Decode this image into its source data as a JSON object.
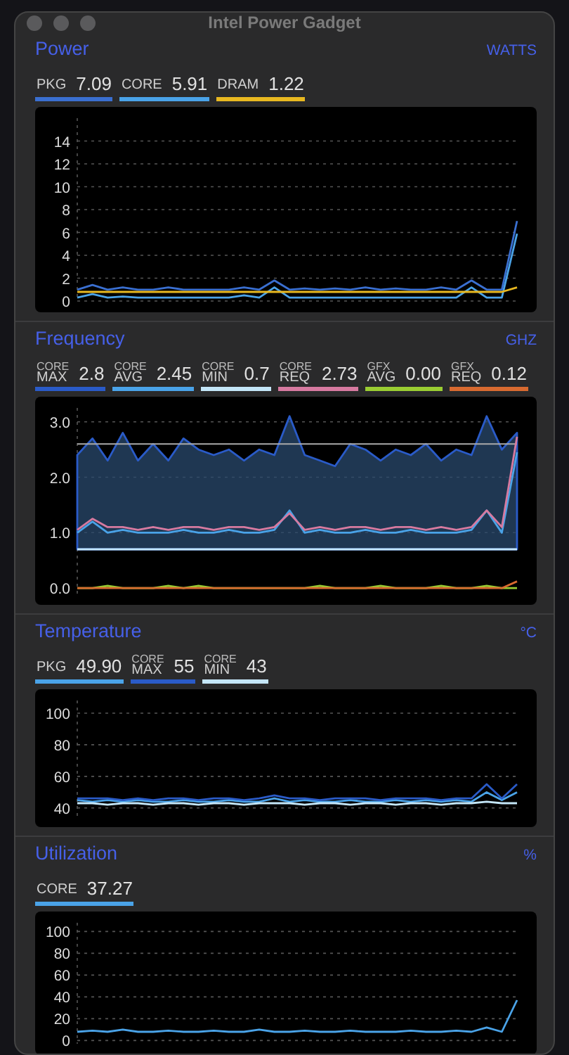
{
  "window": {
    "title": "Intel Power Gadget"
  },
  "sections": [
    {
      "title": "Power",
      "unit": "WATTS",
      "metrics": [
        {
          "label": "PKG",
          "value": "7.09",
          "color": "#3a6fd0"
        },
        {
          "label": "CORE",
          "value": "5.91",
          "color": "#4aa3e8"
        },
        {
          "label": "DRAM",
          "value": "1.22",
          "color": "#e8b820"
        }
      ],
      "chart_data": {
        "type": "line",
        "grid": true,
        "ylim": [
          0,
          16
        ],
        "yticks": [
          0,
          2,
          4,
          6,
          8,
          10,
          12,
          14
        ],
        "series": [
          {
            "color": "#3a6fd0",
            "values": [
              1.0,
              1.4,
              1.0,
              1.2,
              1.0,
              1.0,
              1.2,
              1.0,
              1.0,
              1.0,
              1.0,
              1.2,
              1.0,
              1.8,
              1.0,
              1.1,
              1.0,
              1.1,
              1.0,
              1.2,
              1.0,
              1.1,
              1.0,
              1.0,
              1.2,
              1.0,
              1.8,
              1.0,
              1.0,
              7.0
            ]
          },
          {
            "color": "#4aa3e8",
            "values": [
              0.3,
              0.6,
              0.3,
              0.4,
              0.3,
              0.3,
              0.3,
              0.3,
              0.3,
              0.3,
              0.3,
              0.5,
              0.3,
              1.2,
              0.3,
              0.3,
              0.3,
              0.3,
              0.3,
              0.3,
              0.3,
              0.3,
              0.3,
              0.3,
              0.3,
              0.3,
              1.2,
              0.3,
              0.3,
              5.9
            ]
          },
          {
            "color": "#e8b820",
            "values": [
              0.8,
              0.8,
              0.8,
              0.8,
              0.8,
              0.8,
              0.8,
              0.8,
              0.8,
              0.8,
              0.8,
              0.8,
              0.8,
              0.8,
              0.8,
              0.8,
              0.8,
              0.8,
              0.8,
              0.8,
              0.8,
              0.8,
              0.8,
              0.8,
              0.8,
              0.8,
              0.8,
              0.8,
              0.8,
              1.2
            ]
          }
        ]
      }
    },
    {
      "title": "Frequency",
      "unit": "GHZ",
      "metrics": [
        {
          "label_top": "CORE",
          "label": "MAX",
          "value": "2.8",
          "color": "#2a5bc8"
        },
        {
          "label_top": "CORE",
          "label": "AVG",
          "value": "2.45",
          "color": "#4aa3e8"
        },
        {
          "label_top": "CORE",
          "label": "MIN",
          "value": "0.7",
          "color": "#c4e6f8"
        },
        {
          "label_top": "CORE",
          "label": "REQ",
          "value": "2.73",
          "color": "#d77aa0"
        },
        {
          "label_top": "GFX",
          "label": "AVG",
          "value": "0.00",
          "color": "#9acd32"
        },
        {
          "label_top": "GFX",
          "label": "REQ",
          "value": "0.12",
          "color": "#d86a30"
        }
      ],
      "chart_data": {
        "type": "line",
        "grid": true,
        "ylim": [
          -0.1,
          3.25
        ],
        "yticks": [
          {
            "value": 0,
            "label": "0.0"
          },
          {
            "value": 1,
            "label": "1.0"
          },
          {
            "value": 2,
            "label": "2.0"
          },
          {
            "value": 3,
            "label": "3.0"
          }
        ],
        "ref_lines": [
          {
            "axis": "y",
            "value": 2.6
          }
        ],
        "series": [
          {
            "type": "area",
            "color": "#2a5bc8",
            "values": [
              2.4,
              2.7,
              2.3,
              2.8,
              2.3,
              2.6,
              2.3,
              2.7,
              2.5,
              2.4,
              2.5,
              2.3,
              2.5,
              2.4,
              3.1,
              2.4,
              2.3,
              2.2,
              2.6,
              2.5,
              2.3,
              2.5,
              2.4,
              2.6,
              2.3,
              2.5,
              2.4,
              3.1,
              2.5,
              2.8
            ]
          },
          {
            "color": "#4aa3e8",
            "values": [
              1.0,
              1.2,
              1.0,
              1.05,
              1.0,
              1.0,
              1.0,
              1.05,
              1.0,
              1.0,
              1.05,
              1.0,
              1.0,
              1.05,
              1.4,
              1.0,
              1.05,
              1.0,
              1.0,
              1.05,
              1.0,
              1.0,
              1.05,
              1.0,
              1.0,
              1.0,
              1.05,
              1.4,
              1.0,
              2.45
            ]
          },
          {
            "color": "#c4e6f8",
            "values": [
              0.7,
              0.7,
              0.7,
              0.7,
              0.7,
              0.7,
              0.7,
              0.7,
              0.7,
              0.7,
              0.7,
              0.7,
              0.7,
              0.7,
              0.7,
              0.7,
              0.7,
              0.7,
              0.7,
              0.7,
              0.7,
              0.7,
              0.7,
              0.7,
              0.7,
              0.7,
              0.7,
              0.7,
              0.7,
              0.7
            ]
          },
          {
            "color": "#d77aa0",
            "values": [
              1.05,
              1.25,
              1.1,
              1.1,
              1.05,
              1.1,
              1.05,
              1.1,
              1.1,
              1.05,
              1.1,
              1.1,
              1.05,
              1.1,
              1.35,
              1.05,
              1.1,
              1.05,
              1.1,
              1.1,
              1.05,
              1.1,
              1.1,
              1.05,
              1.1,
              1.05,
              1.1,
              1.4,
              1.1,
              2.73
            ]
          },
          {
            "color": "#9acd32",
            "values": [
              0,
              0,
              0.04,
              0,
              0,
              0,
              0.04,
              0,
              0.04,
              0,
              0,
              0,
              0,
              0,
              0,
              0,
              0.04,
              0,
              0,
              0,
              0.04,
              0,
              0,
              0,
              0.04,
              0,
              0,
              0.04,
              0,
              0
            ]
          },
          {
            "color": "#d86a30",
            "values": [
              0,
              0,
              0,
              0,
              0,
              0,
              0,
              0,
              0,
              0,
              0,
              0,
              0,
              0,
              0,
              0,
              0,
              0,
              0,
              0,
              0,
              0,
              0,
              0,
              0,
              0,
              0,
              0,
              0,
              0.12
            ]
          }
        ]
      }
    },
    {
      "title": "Temperature",
      "unit": "°C",
      "metrics": [
        {
          "label": "PKG",
          "value": "49.90",
          "color": "#4aa3e8"
        },
        {
          "label_top": "CORE",
          "label": "MAX",
          "value": "55",
          "color": "#2a5bc8"
        },
        {
          "label_top": "CORE",
          "label": "MIN",
          "value": "43",
          "color": "#c4e6f8"
        }
      ],
      "chart_data": {
        "type": "line",
        "grid": true,
        "ylim": [
          35,
          108
        ],
        "yticks": [
          40,
          60,
          80,
          100
        ],
        "series": [
          {
            "color": "#4aa3e8",
            "values": [
              45,
              44,
              45,
              44,
              45,
              44,
              44,
              45,
              44,
              44,
              45,
              44,
              44,
              46,
              44,
              45,
              44,
              44,
              45,
              44,
              44,
              45,
              44,
              45,
              44,
              45,
              44,
              50,
              45,
              50
            ]
          },
          {
            "color": "#2a5bc8",
            "values": [
              46,
              46,
              46,
              45,
              46,
              45,
              46,
              46,
              45,
              46,
              46,
              45,
              46,
              48,
              46,
              46,
              45,
              46,
              46,
              46,
              45,
              46,
              46,
              46,
              45,
              46,
              46,
              55,
              46,
              55
            ]
          },
          {
            "color": "#c4e6f8",
            "values": [
              43,
              43,
              42,
              43,
              43,
              42,
              43,
              43,
              42,
              43,
              43,
              42,
              43,
              43,
              43,
              42,
              43,
              43,
              42,
              43,
              43,
              42,
              43,
              43,
              42,
              43,
              43,
              44,
              43,
              43
            ]
          }
        ]
      }
    },
    {
      "title": "Utilization",
      "unit": "%",
      "metrics": [
        {
          "label": "CORE",
          "value": "37.27",
          "color": "#4aa3e8"
        }
      ],
      "chart_data": {
        "type": "line",
        "grid": true,
        "ylim": [
          -3,
          108
        ],
        "yticks": [
          0,
          20,
          40,
          60,
          80,
          100
        ],
        "series": [
          {
            "color": "#4aa3e8",
            "values": [
              8,
              9,
              8,
              10,
              8,
              8,
              9,
              8,
              8,
              9,
              8,
              8,
              10,
              8,
              8,
              9,
              8,
              8,
              9,
              8,
              8,
              8,
              9,
              8,
              8,
              9,
              8,
              12,
              8,
              37
            ]
          }
        ]
      }
    }
  ]
}
